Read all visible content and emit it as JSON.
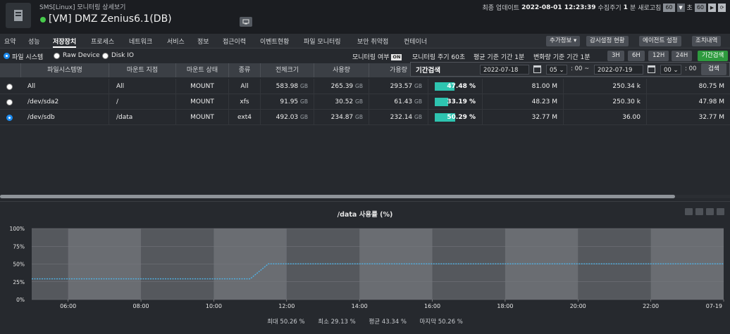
{
  "header": {
    "subtitle": "SMS[Linux] 모니터링 상세보기",
    "server_name": "[VM] DMZ Zenius6.1(DB)",
    "last_update_label": "최종 업데이트",
    "last_update_value": "2022-08-01 12:23:39",
    "collect_label": "수집주기",
    "collect_value": "1",
    "collect_unit": "분",
    "refresh_label": "새로고침",
    "refresh_value": "60",
    "sec_label": "초",
    "sec_value": "60"
  },
  "tabs": [
    "요약",
    "성능",
    "저장장치",
    "프로세스",
    "네트워크",
    "서비스",
    "정보",
    "접근이력",
    "이벤트현황",
    "파일 모니터링",
    "보안 취약점",
    "컨테이너"
  ],
  "tab_buttons": {
    "extra_info": "추가정보",
    "watch_status": "감시설정 현황",
    "agent_setting": "에이전트 설정",
    "action_history": "조치내역"
  },
  "options": {
    "radio_filesystem": "파일 시스템",
    "radio_raw": "Raw Device",
    "radio_diskio": "Disk IO",
    "monitoring_label": "모니터링 여부",
    "monitoring_badge": "ON",
    "cycle_text": "모니터링 주기 60초",
    "avg_text": "평균 기준 기간 1분",
    "change_text": "변화량 기준 기간 1분",
    "btn_3h": "3H",
    "btn_6h": "6H",
    "btn_12h": "12H",
    "btn_24h": "24H",
    "btn_period": "기간검색"
  },
  "period": {
    "title": "기간검색",
    "start_date": "2022-07-18",
    "start_hour": "05",
    "start_min": ": 00 ~",
    "end_date": "2022-07-19",
    "end_hour": "00",
    "end_min": ": 00",
    "search": "검색"
  },
  "table": {
    "headers": [
      "파일시스템명",
      "마운트 지점",
      "마운트 상태",
      "종류",
      "전체크기",
      "사용량",
      "가용량"
    ],
    "unit": "GB",
    "rows": [
      {
        "name": "All",
        "mount": "All",
        "state": "MOUNT",
        "type": "All",
        "total": "583.98",
        "used": "265.39",
        "avail": "293.57",
        "pct_label": "47.48 %",
        "pct": 47.48,
        "c1": "81.00 M",
        "c2": "250.34 k",
        "c3": "80.75 M",
        "selected": false
      },
      {
        "name": "/dev/sda2",
        "mount": "/",
        "state": "MOUNT",
        "type": "xfs",
        "total": "91.95",
        "used": "30.52",
        "avail": "61.43",
        "pct_label": "33.19 %",
        "pct": 33.19,
        "c1": "48.23 M",
        "c2": "250.30 k",
        "c3": "47.98 M",
        "selected": false
      },
      {
        "name": "/dev/sdb",
        "mount": "/data",
        "state": "MOUNT",
        "type": "ext4",
        "total": "492.03",
        "used": "234.87",
        "avail": "232.14",
        "pct_label": "50.29 %",
        "pct": 50.29,
        "c1": "32.77 M",
        "c2": "36.00",
        "c3": "32.77 M",
        "selected": true
      }
    ]
  },
  "chart_data": {
    "type": "line",
    "title": "/data 사용률 (%)",
    "ylim": [
      0,
      100
    ],
    "yticks": [
      "0%",
      "25%",
      "50%",
      "75%",
      "100%"
    ],
    "xticks": [
      "06:00",
      "08:00",
      "10:00",
      "12:00",
      "14:00",
      "16:00",
      "18:00",
      "20:00",
      "22:00",
      "07-19"
    ],
    "x": [
      "05:00",
      "11:00",
      "11:30",
      "07-19 00:00"
    ],
    "y": [
      29.13,
      29.13,
      50.26,
      50.26
    ],
    "line_color": "#4fb3e8",
    "stats": {
      "max": "최대 50.26 %",
      "min": "최소 29.13 %",
      "avg": "평균 43.34 %",
      "last": "마지막 50.26 %"
    }
  }
}
